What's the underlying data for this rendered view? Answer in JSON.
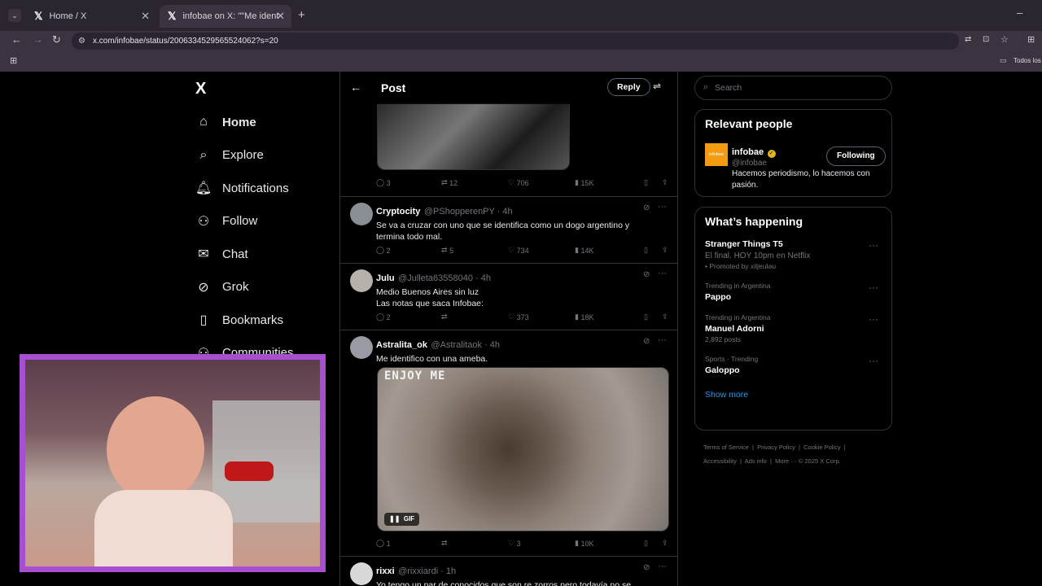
{
  "browser": {
    "tabs": [
      {
        "title": "Home / X"
      },
      {
        "title": "infobae on X: \"\"Me identifico c"
      }
    ],
    "url": "x.com/infobae/status/2006334529565524062?s=20",
    "bookmarks_label": "Todos los"
  },
  "sidebar": {
    "logo": "X",
    "items": [
      {
        "label": "Home"
      },
      {
        "label": "Explore"
      },
      {
        "label": "Notifications"
      },
      {
        "label": "Follow"
      },
      {
        "label": "Chat"
      },
      {
        "label": "Grok"
      },
      {
        "label": "Bookmarks"
      },
      {
        "label": "Communities"
      }
    ]
  },
  "feed": {
    "title": "Post",
    "reply_button": "Reply",
    "top_stats": {
      "replies": "3",
      "reposts": "12",
      "likes": "706",
      "views": "15K"
    },
    "tweets": [
      {
        "name": "Cryptocity",
        "handle": "@PShopperenPY · 4h",
        "text": "Se va a cruzar con uno que se identifica como un dogo argentino y termina todo mal.",
        "replies": "2",
        "reposts": "5",
        "likes": "734",
        "views": "14K"
      },
      {
        "name": "Julu",
        "handle": "@Julleta63558040 · 4h",
        "text": "Medio Buenos Aires sin luz",
        "text2": "Las notas que saca Infobae:",
        "replies": "2",
        "reposts": "",
        "likes": "373",
        "views": "18K"
      },
      {
        "name": "Astralita_ok",
        "handle": "@Astralitaok · 4h",
        "text": "Me identifico con una ameba.",
        "media_caption": "ENJOY ME",
        "gif_label": "GIF",
        "replies": "1",
        "reposts": "",
        "likes": "3",
        "views": "10K"
      },
      {
        "name": "rixxi",
        "handle": "@rixxiardi · 1h",
        "text": "Yo tengo un par de conocidos que son re zorros pero todavía no se"
      }
    ]
  },
  "right": {
    "search_placeholder": "Search",
    "relevant_title": "Relevant people",
    "person": {
      "name": "infobae",
      "handle": "@infobae",
      "bio": "Hacemos periodismo, lo hacemos con pasión.",
      "follow_label": "Following",
      "avatar_text": "infobae"
    },
    "happening_title": "What’s happening",
    "trends": [
      {
        "topic": "Stranger Things T5",
        "line1": "El final. HOY 10pm en Netflix",
        "line2": "Promoted by xiljɐuʇǝu"
      },
      {
        "meta": "Trending in Argentina",
        "topic": "Pappo"
      },
      {
        "meta": "Trending in Argentina",
        "topic": "Manuel Adorni",
        "posts": "2,892 posts"
      },
      {
        "meta": "Sports · Trending",
        "topic": "Galoppo"
      }
    ],
    "show_more": "Show more",
    "footer": [
      "Terms of Service",
      "Privacy Policy",
      "Cookie Policy",
      "Accessibility",
      "Ads info",
      "More ···",
      "© 2025 X Corp."
    ]
  },
  "colors": {
    "accent": "#1d9bf0",
    "webcam_border": "#a84fd1",
    "infobae_orange": "#f39c12"
  }
}
